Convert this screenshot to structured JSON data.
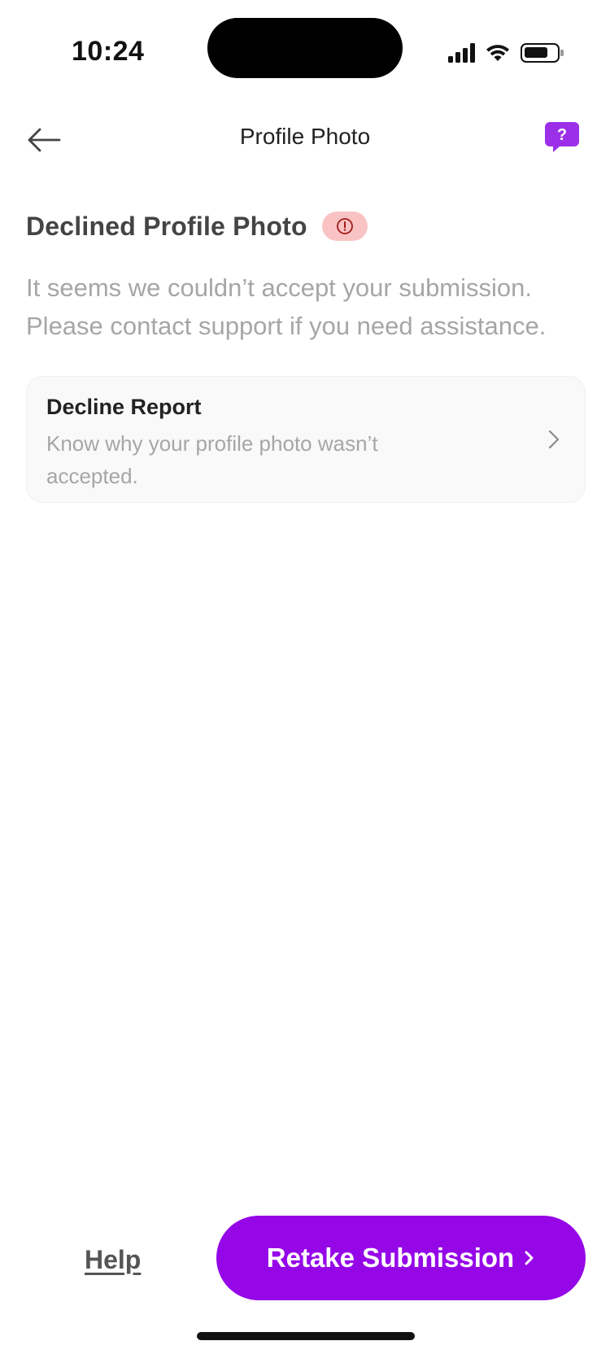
{
  "status_bar": {
    "time": "10:24",
    "battery_level": 0.75
  },
  "nav": {
    "title": "Profile Photo",
    "back_icon": "arrow-left-icon",
    "help_icon": "question-chat-icon"
  },
  "status": {
    "heading": "Declined Profile Photo",
    "badge_icon": "alert-circle-icon",
    "description": "It seems we couldn’t accept your submission. Please contact support if you need assistance."
  },
  "report_card": {
    "title": "Decline Report",
    "subtitle": "Know why your profile photo wasn’t accepted."
  },
  "actions": {
    "help_label": "Help",
    "retake_label": "Retake Submission"
  },
  "colors": {
    "accent": "#9607E8",
    "badge_bg": "#F9C3C4",
    "badge_fg": "#A11A1A",
    "muted_text": "#A6A6A6"
  }
}
